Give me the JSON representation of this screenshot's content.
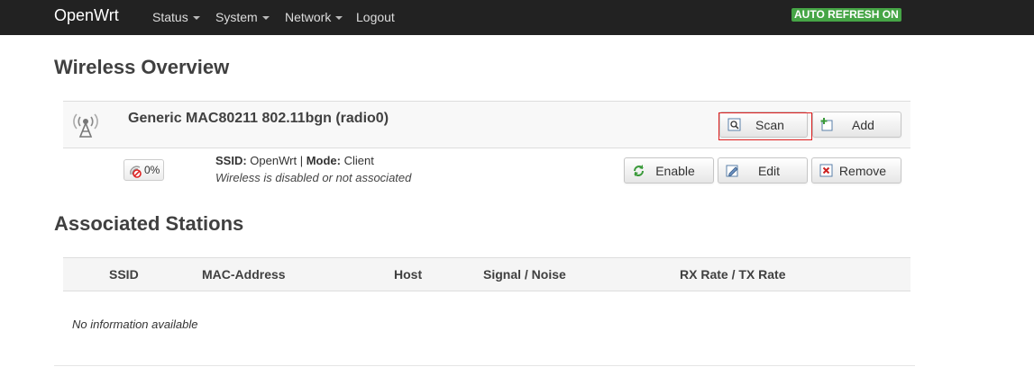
{
  "navbar": {
    "brand": "OpenWrt",
    "items": [
      {
        "label": "Status",
        "dropdown": true
      },
      {
        "label": "System",
        "dropdown": true
      },
      {
        "label": "Network",
        "dropdown": true
      },
      {
        "label": "Logout",
        "dropdown": false
      }
    ],
    "auto_refresh": "AUTO REFRESH ON"
  },
  "wireless": {
    "title": "Wireless Overview",
    "device": {
      "name": "Generic MAC80211 802.11bgn (radio0)",
      "icon": "wifi-radio-icon",
      "buttons": {
        "scan": "Scan",
        "add": "Add"
      }
    },
    "interface": {
      "signal": "0%",
      "ssid_label": "SSID:",
      "ssid_value": "OpenWrt",
      "separator": "|",
      "mode_label": "Mode:",
      "mode_value": "Client",
      "status": "Wireless is disabled or not associated",
      "buttons": {
        "enable": "Enable",
        "edit": "Edit",
        "remove": "Remove"
      }
    }
  },
  "stations": {
    "title": "Associated Stations",
    "columns": [
      "SSID",
      "MAC-Address",
      "Host",
      "Signal / Noise",
      "RX Rate / TX Rate"
    ],
    "empty": "No information available"
  },
  "colors": {
    "navbar_bg": "#222222",
    "auto_refresh_bg": "#46a546",
    "highlight_border": "#e02020"
  }
}
